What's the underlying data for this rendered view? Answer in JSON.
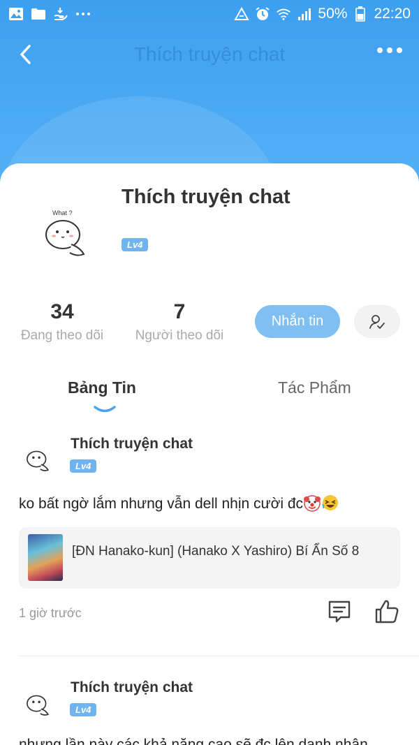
{
  "status_bar": {
    "icons": [
      "image-icon",
      "folder-icon",
      "hand-icon",
      "more-icon",
      "recycle-icon",
      "alarm-icon",
      "wifi-icon",
      "signal-icon",
      "battery-icon"
    ],
    "battery": "50%",
    "time": "22:20"
  },
  "topbar": {
    "title": "Thích truyện chat"
  },
  "profile": {
    "name": "Thích truyện chat",
    "level": "Lv4",
    "avatar_caption": "What ?",
    "stats": {
      "following_count": "34",
      "following_label": "Đang theo dõi",
      "followers_count": "7",
      "followers_label": "Người theo dõi"
    },
    "message_button": "Nhắn tin"
  },
  "tabs": {
    "news": "Bảng Tin",
    "works": "Tác Phẩm"
  },
  "posts": [
    {
      "author": "Thích truyện chat",
      "level": "Lv4",
      "text": "ko bất ngờ lắm nhưng vẫn dell nhịn cười đc",
      "emojis": [
        "clown-face",
        "grinning-squinting-face"
      ],
      "book_title": "[ĐN Hanako-kun] (Hanako X Yashiro) Bí Ẩn Số 8",
      "time": "1 giờ trước"
    },
    {
      "author": "Thích truyện chat",
      "level": "Lv4",
      "text": "nhưng lần này các khả năng cao sẽ đc lên danh nhân"
    }
  ],
  "colors": {
    "header_blue": "#3d9ff0",
    "accent": "#7fbff2",
    "badge": "#6fb4ef"
  }
}
